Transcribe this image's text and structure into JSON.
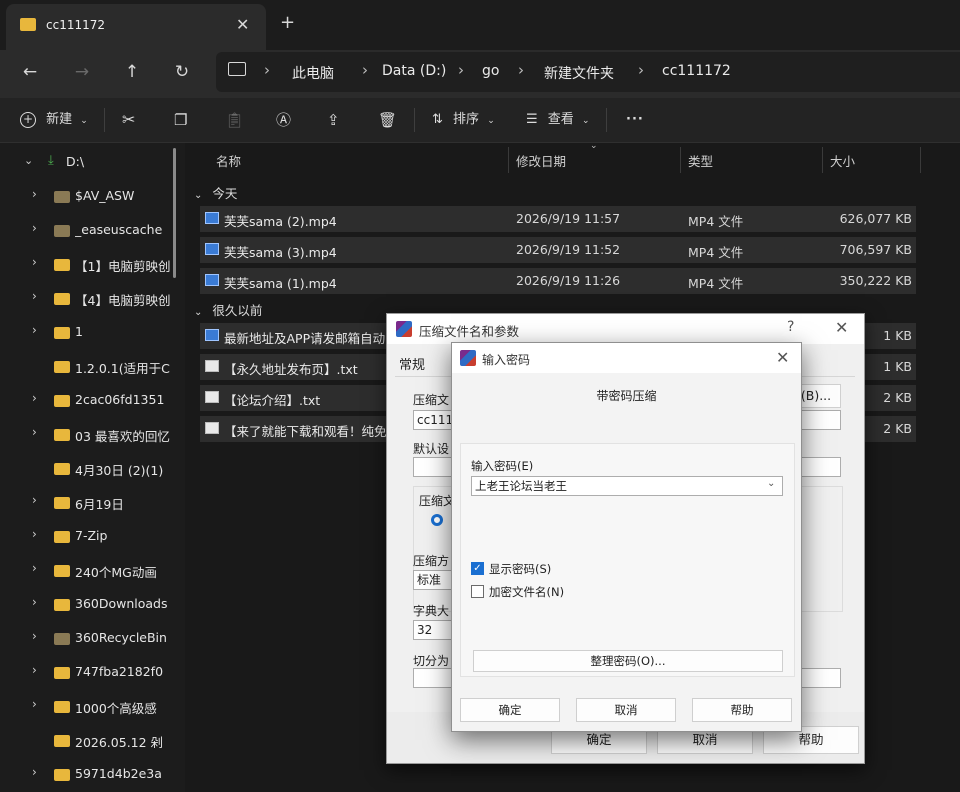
{
  "tab": {
    "title": "cc111172"
  },
  "breadcrumb": [
    "此电脑",
    "Data (D:)",
    "go",
    "新建文件夹",
    "cc111172"
  ],
  "toolbar": {
    "new_label": "新建",
    "sort_label": "排序",
    "view_label": "查看",
    "more_label": "···"
  },
  "sidebar": {
    "drive": "D:\\",
    "items": [
      {
        "label": "$AV_ASW",
        "chevron": true,
        "gray": true
      },
      {
        "label": "_easeuscache",
        "chevron": true,
        "gray": true
      },
      {
        "label": "【1】电脑剪映创",
        "chevron": true,
        "gray": false
      },
      {
        "label": "【4】电脑剪映创",
        "chevron": true,
        "gray": false
      },
      {
        "label": "1",
        "chevron": true,
        "gray": false
      },
      {
        "label": "1.2.0.1(适用于C",
        "chevron": false,
        "gray": false
      },
      {
        "label": "2cac06fd1351",
        "chevron": true,
        "gray": false
      },
      {
        "label": "03 最喜欢的回忆",
        "chevron": true,
        "gray": false
      },
      {
        "label": "4月30日 (2)(1)",
        "chevron": false,
        "gray": false
      },
      {
        "label": "6月19日",
        "chevron": true,
        "gray": false
      },
      {
        "label": "7-Zip",
        "chevron": true,
        "gray": false
      },
      {
        "label": "240个MG动画",
        "chevron": true,
        "gray": false
      },
      {
        "label": "360Downloads",
        "chevron": true,
        "gray": false
      },
      {
        "label": "360RecycleBin",
        "chevron": true,
        "gray": true
      },
      {
        "label": "747fba2182f0",
        "chevron": true,
        "gray": false
      },
      {
        "label": "1000个高级感",
        "chevron": true,
        "gray": false
      },
      {
        "label": "2026.05.12 剁",
        "chevron": false,
        "gray": false
      },
      {
        "label": "5971d4b2e3a",
        "chevron": true,
        "gray": false
      }
    ]
  },
  "columns": {
    "name": "名称",
    "modified": "修改日期",
    "type": "类型",
    "size": "大小"
  },
  "groups": {
    "today": "今天",
    "long_ago": "很久以前"
  },
  "files_today": [
    {
      "name": "芙芙sama (2).mp4",
      "modified": "2026/9/19 11:57",
      "type": "MP4 文件",
      "size": "626,077 KB"
    },
    {
      "name": "芙芙sama (3).mp4",
      "modified": "2026/9/19 11:52",
      "type": "MP4 文件",
      "size": "706,597 KB"
    },
    {
      "name": "芙芙sama (1).mp4",
      "modified": "2026/9/19 11:26",
      "type": "MP4 文件",
      "size": "350,222 KB"
    }
  ],
  "files_old": [
    {
      "name": "最新地址及APP请发邮箱自动",
      "size": "1 KB"
    },
    {
      "name": "【永久地址发布页】.txt",
      "size": "1 KB"
    },
    {
      "name": "【论坛介绍】.txt",
      "size": "2 KB"
    },
    {
      "name": "【来了就能下载和观看！纯免",
      "size": "2 KB"
    }
  ],
  "rar_dialog": {
    "title": "压缩文件名和参数",
    "help_glyph": "?",
    "tab_general": "常规",
    "label_archive": "压缩文",
    "archive_name": "cc1111",
    "browse_button": "(B)...",
    "label_default": "默认设",
    "label_format": "压缩文",
    "label_method": "压缩方",
    "method_value": "标准",
    "label_dict": "字典大",
    "dict_value": "32",
    "label_split": "切分为",
    "ok": "确定",
    "cancel": "取消",
    "help": "帮助"
  },
  "pwd_dialog": {
    "title": "输入密码",
    "heading": "带密码压缩",
    "password_label": "输入密码(E)",
    "password_value": "上老王论坛当老王",
    "show_password": "显示密码(S)",
    "show_password_checked": true,
    "encrypt_names": "加密文件名(N)",
    "encrypt_names_checked": false,
    "organize_button": "整理密码(O)...",
    "ok": "确定",
    "cancel": "取消",
    "help": "帮助"
  }
}
